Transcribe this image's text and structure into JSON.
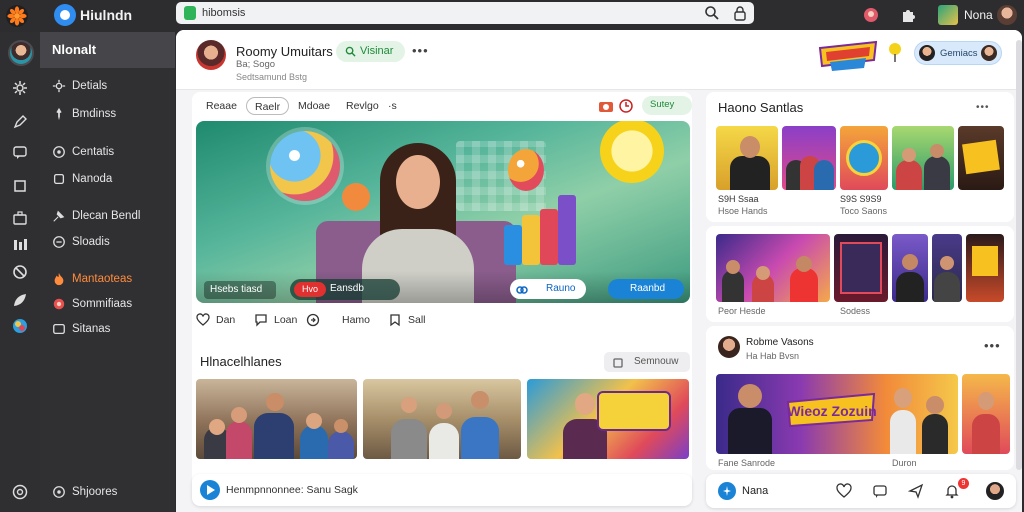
{
  "topbar": {
    "app_title": "Hiulndn",
    "url": "hibomsis",
    "profile_name": "Nona"
  },
  "sidebar": {
    "title": "Nlonalt",
    "items": [
      {
        "label": "Detials",
        "icon": "gear-icon"
      },
      {
        "label": "Bmdinss",
        "icon": "pin-icon"
      },
      {
        "label": "Centatis",
        "icon": "chat-icon"
      },
      {
        "label": "Nanoda",
        "icon": "square-icon"
      },
      {
        "label": "Dlecan Bendl",
        "icon": "briefcase-icon"
      },
      {
        "label": "Sloadis",
        "icon": "bars-icon"
      },
      {
        "label": "Mantaoteas",
        "icon": "flame-icon",
        "active": true
      },
      {
        "label": "Sommifiaas",
        "icon": "sparkle-icon"
      },
      {
        "label": "Sitanas",
        "icon": "grid-icon"
      }
    ],
    "footer_label": "Shjoores"
  },
  "header": {
    "name": "Roomy Umuitars",
    "sub1": "Ba; Sogo",
    "sub2": "Sedtsamund Bstg",
    "visibility_label": "Visinar",
    "group_label": "Gemiacs"
  },
  "feed": {
    "tabs": [
      "Reaae",
      "Raelr",
      "Mdoae",
      "Revlgo",
      "·s"
    ],
    "active_tab": 1,
    "live_label": "Sutey",
    "hero": {
      "caption": "Hsebs tiasd",
      "live_tag": "Hvo",
      "live_text": "Eansdb",
      "button1": "Rauno",
      "button2": "Raanbd"
    },
    "actions": [
      {
        "label": "Dan",
        "icon": "heart-icon"
      },
      {
        "label": "Loan",
        "icon": "comment-icon"
      },
      {
        "label": "Hamo",
        "icon": "share-icon"
      },
      {
        "label": "Sall",
        "icon": "save-icon"
      }
    ],
    "section_title": "Hlnacelhlanes",
    "section_button": "Semnouw",
    "composer": "Henmpnnonnee:   Sanu Sagk"
  },
  "right": {
    "panel_title": "Haono Santlas",
    "captions_row1": [
      "S9H Ssaa",
      "Hsoe Hands",
      "S9S S9S9",
      "Toco Saons"
    ],
    "captions_row2": [
      "Peor Hesde",
      "Sodess"
    ],
    "post_name": "Robme Vasons",
    "post_sub": "Ha Hab Bvsn",
    "captions_row3": [
      "Fane Sanrode",
      "Duron"
    ],
    "banner_text": "Wieoz Zozuin",
    "dock_label": "Nana",
    "dock_badge": "9"
  },
  "colors": {
    "accent_blue": "#1a83d6",
    "accent_green": "#1f8a3a",
    "active_nav": "#ff8b3d",
    "sidebar_bg": "#303033"
  }
}
